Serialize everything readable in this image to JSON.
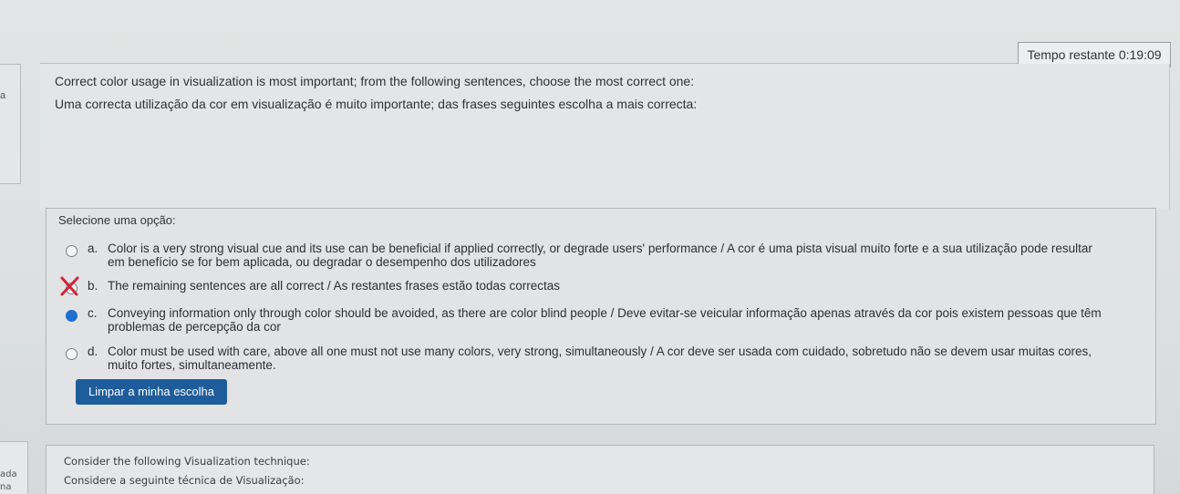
{
  "timer": {
    "label": "Tempo restante",
    "value": "0:19:09"
  },
  "left_nav": {
    "frag1": "a",
    "frag2": "ada",
    "frag3": "na"
  },
  "question": {
    "text_en": "Correct color usage in visualization is most important; from the following sentences, choose the most correct one:",
    "text_pt": "Uma correcta utilização da cor em visualização é muito importante; das frases seguintes escolha a mais correcta:"
  },
  "select_label": "Selecione uma opção:",
  "options": [
    {
      "letter": "a.",
      "line1": "Color is a very strong visual cue and its use can be beneficial if applied correctly, or degrade users' performance / A cor é uma pista visual muito forte e a sua utilização pode resultar",
      "line2": "em benefício se for bem aplicada, ou degradar o desempenho dos utilizadores",
      "selected": false
    },
    {
      "letter": "b.",
      "line1": "The remaining sentences are all correct / As restantes frases estão todas correctas",
      "line2": "",
      "selected": false,
      "marked_wrong": true
    },
    {
      "letter": "c.",
      "line1": "Conveying information only through color should be avoided, as there are color blind people / Deve evitar-se veicular informação apenas através da cor pois existem pessoas que têm",
      "line2": "problemas de percepção da cor",
      "selected": true
    },
    {
      "letter": "d.",
      "line1": "Color must be used with care, above all one must not use many colors, very strong, simultaneously / A cor deve ser usada com cuidado, sobretudo não se devem usar muitas cores,",
      "line2": "muito fortes, simultaneamente.",
      "selected": false
    }
  ],
  "clear_button": "Limpar a minha escolha",
  "next_question": {
    "text_en": "Consider the following Visualization technique:",
    "text_pt": "Considere a seguinte técnica de Visualização:"
  },
  "colors": {
    "accent": "#1e5c9b",
    "selected_radio": "#1f6fd0",
    "wrong_mark": "#d0243a"
  }
}
